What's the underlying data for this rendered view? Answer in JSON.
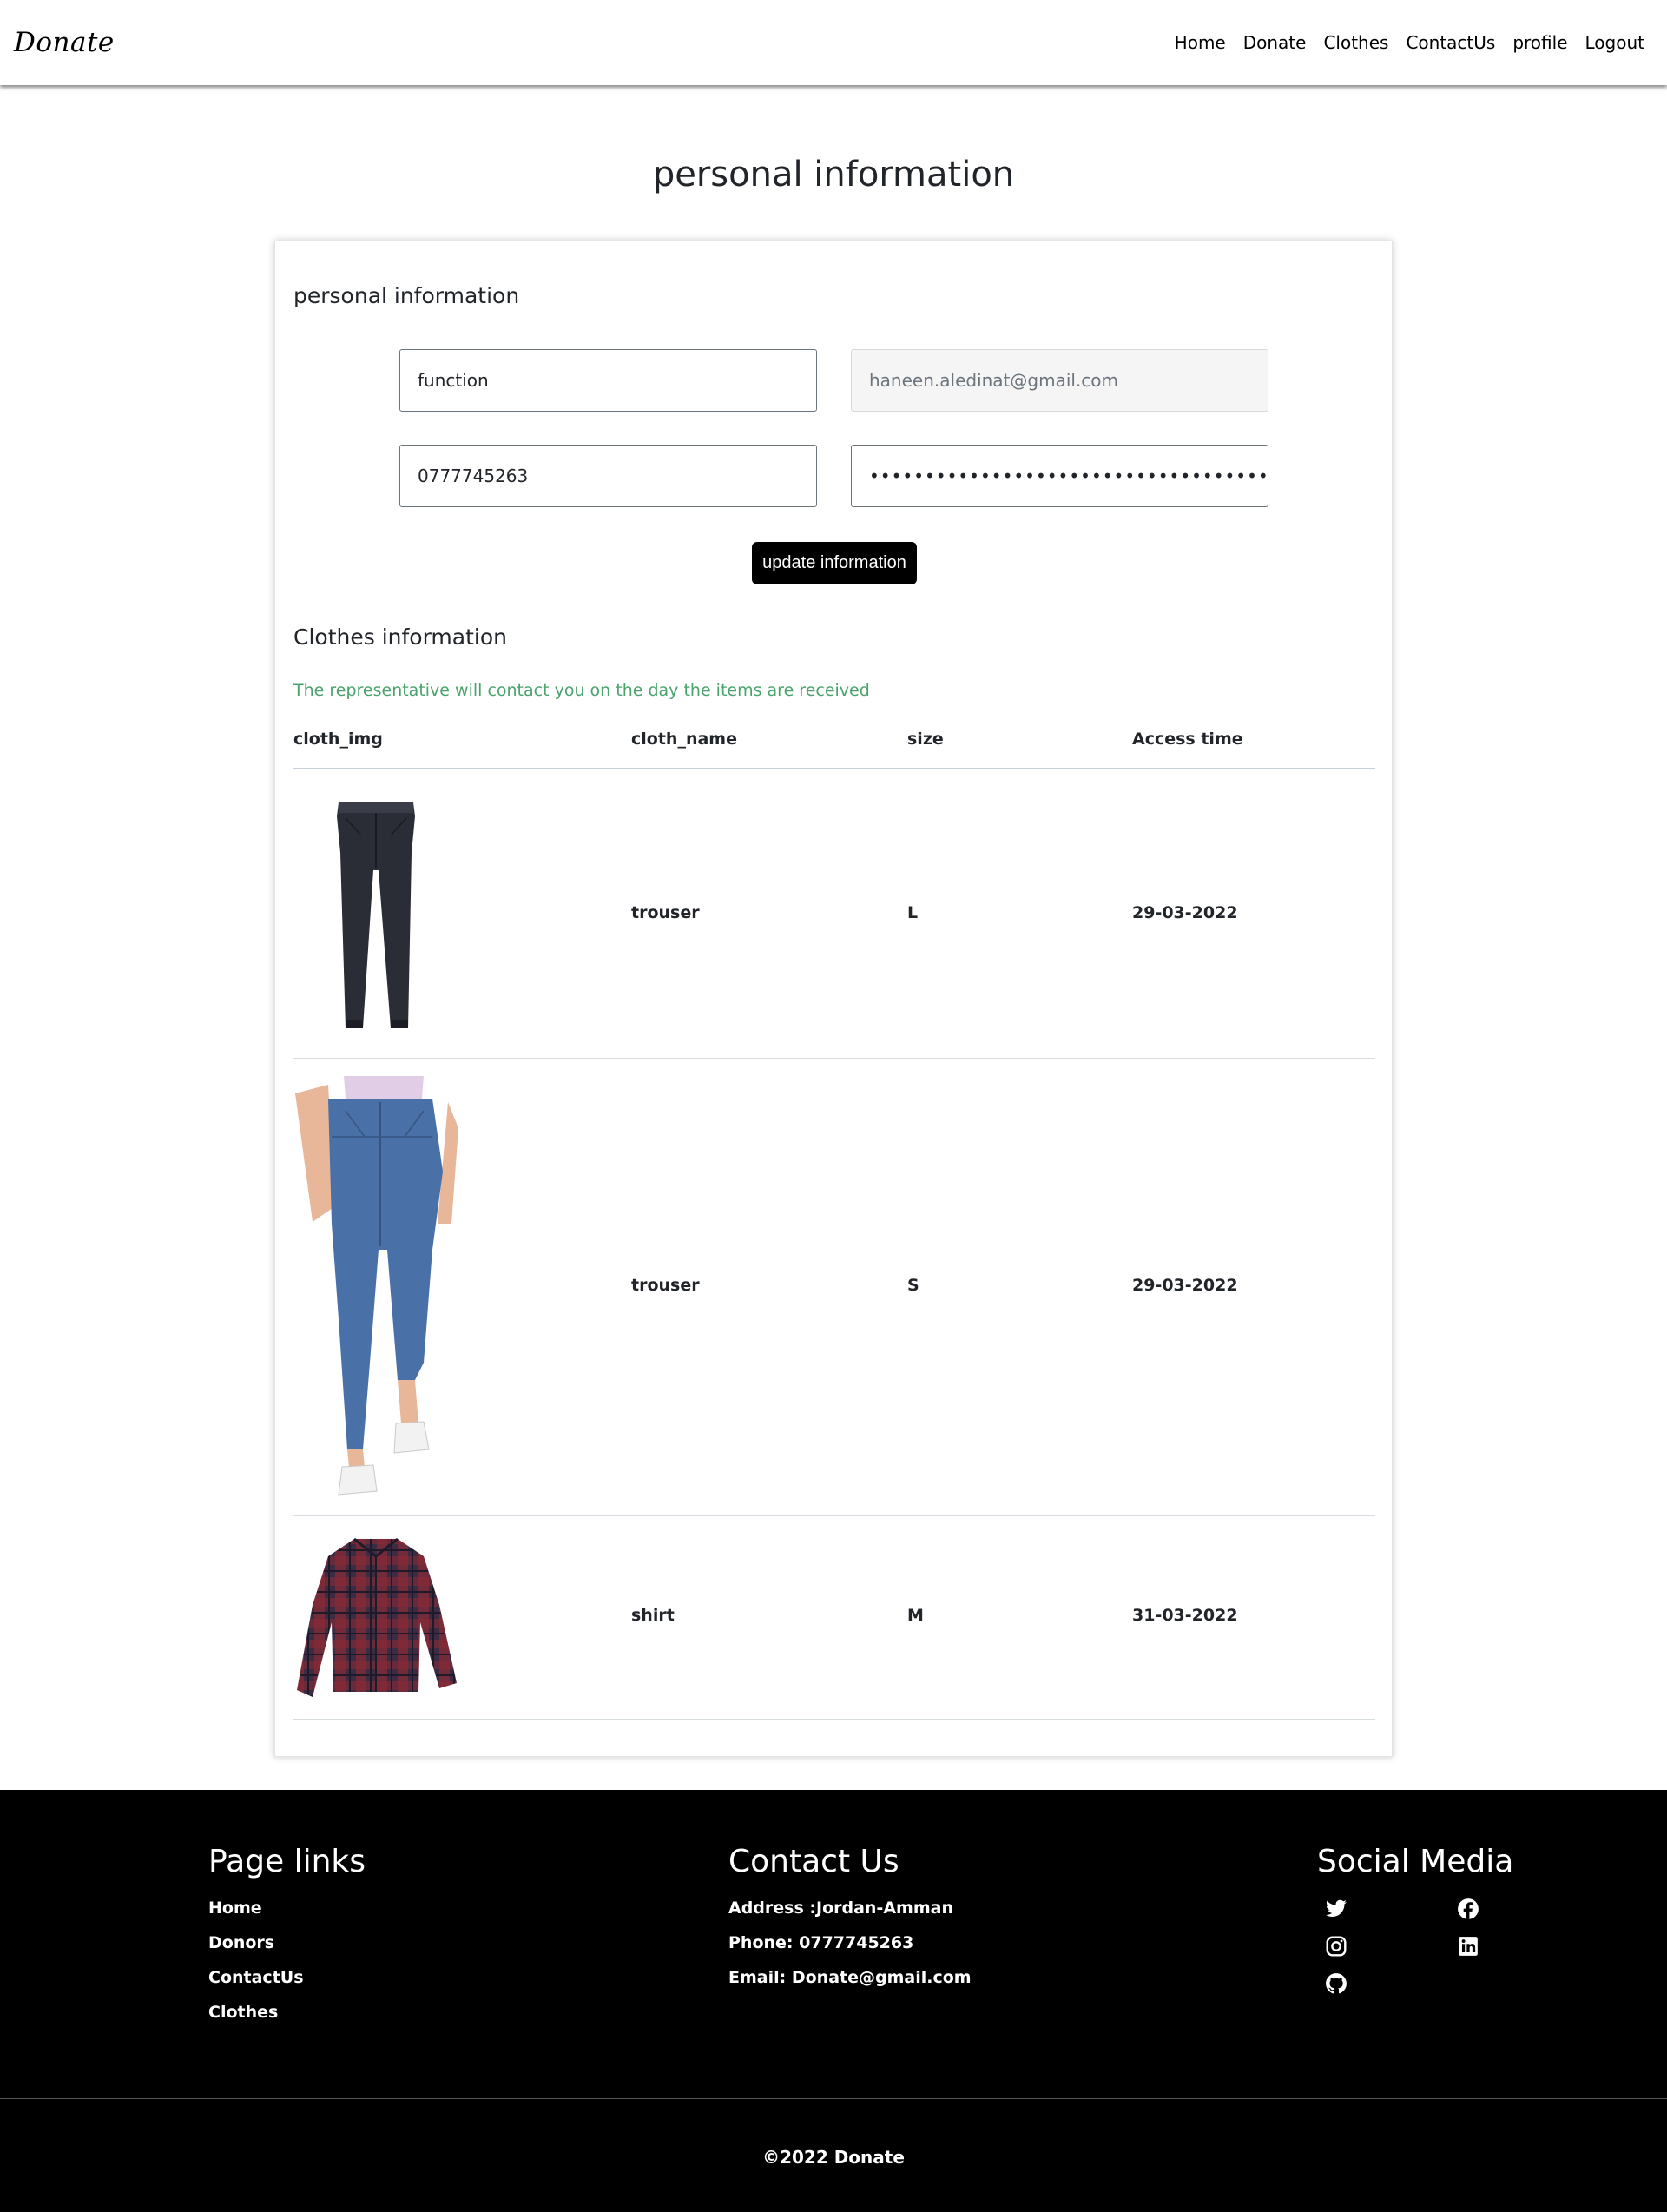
{
  "nav": {
    "brand": "Donate",
    "links": [
      "Home",
      "Donate",
      "Clothes",
      "ContactUs",
      "profile",
      "Logout"
    ]
  },
  "page": {
    "title": "personal information"
  },
  "form": {
    "section_title": "personal information",
    "name_value": "function",
    "email_value": "haneen.aledinat@gmail.com",
    "phone_value": "0777745263",
    "password_value": "•••••••••••••••••••••••••••••••••••••••••••••••••••••••••••••",
    "update_label": "update information"
  },
  "clothes": {
    "section_title": "Clothes information",
    "notice": "The representative will contact you on the day the items are received",
    "columns": [
      "cloth_img",
      "cloth_name",
      "size",
      "Access time"
    ],
    "rows": [
      {
        "name": "trouser",
        "size": "L",
        "time": "29-03-2022",
        "image": "dark-trousers-image"
      },
      {
        "name": "trouser",
        "size": "S",
        "time": "29-03-2022",
        "image": "blue-jeans-image"
      },
      {
        "name": "shirt",
        "size": "M",
        "time": "31-03-2022",
        "image": "plaid-shirt-image"
      }
    ]
  },
  "footer": {
    "page_links_title": "Page links",
    "page_links": [
      "Home",
      "Donors",
      "ContactUs",
      "Clothes"
    ],
    "contact_title": "Contact Us",
    "address": "Address :Jordan-Amman",
    "phone": "Phone: 0777745263",
    "email": "Email: Donate@gmail.com",
    "social_title": "Social Media",
    "social_icons": [
      "twitter-icon",
      "facebook-icon",
      "instagram-icon",
      "linkedin-icon",
      "github-icon"
    ],
    "copyright": "©2022 Donate"
  },
  "colors": {
    "notice": "#4aa36c",
    "footer_bg": "#000000",
    "button_bg": "#000000"
  }
}
